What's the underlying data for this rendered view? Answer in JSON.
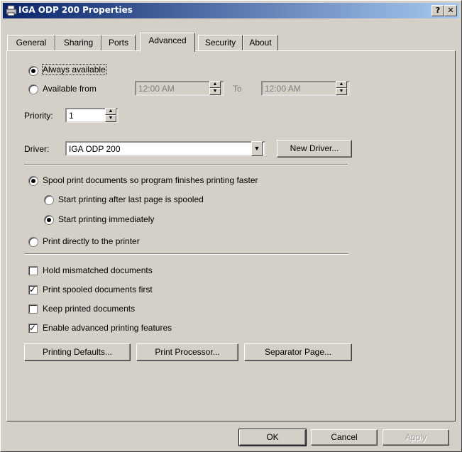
{
  "window": {
    "title": "IGA ODP 200 Properties",
    "help_label": "?",
    "close_label": "✕"
  },
  "tabs": [
    "General",
    "Sharing",
    "Ports",
    "Advanced",
    "Security",
    "About"
  ],
  "availability": {
    "always": "Always available",
    "from": "Available from",
    "from_time": "12:00 AM",
    "to_label": "To",
    "to_time": "12:00 AM"
  },
  "priority": {
    "label": "Priority:",
    "value": "1"
  },
  "driver": {
    "label": "Driver:",
    "value": "IGA ODP 200",
    "new_button": "New Driver..."
  },
  "spool": {
    "spool_option": "Spool print documents so program finishes printing faster",
    "after_last": "Start printing after last page is spooled",
    "immediately": "Start printing immediately",
    "direct": "Print directly to the printer"
  },
  "options": {
    "hold": "Hold mismatched documents",
    "spooled_first": "Print spooled documents first",
    "keep": "Keep printed documents",
    "advanced": "Enable advanced printing features"
  },
  "buttons": {
    "defaults": "Printing Defaults...",
    "processor": "Print Processor...",
    "separator": "Separator Page...",
    "ok": "OK",
    "cancel": "Cancel",
    "apply": "Apply"
  }
}
